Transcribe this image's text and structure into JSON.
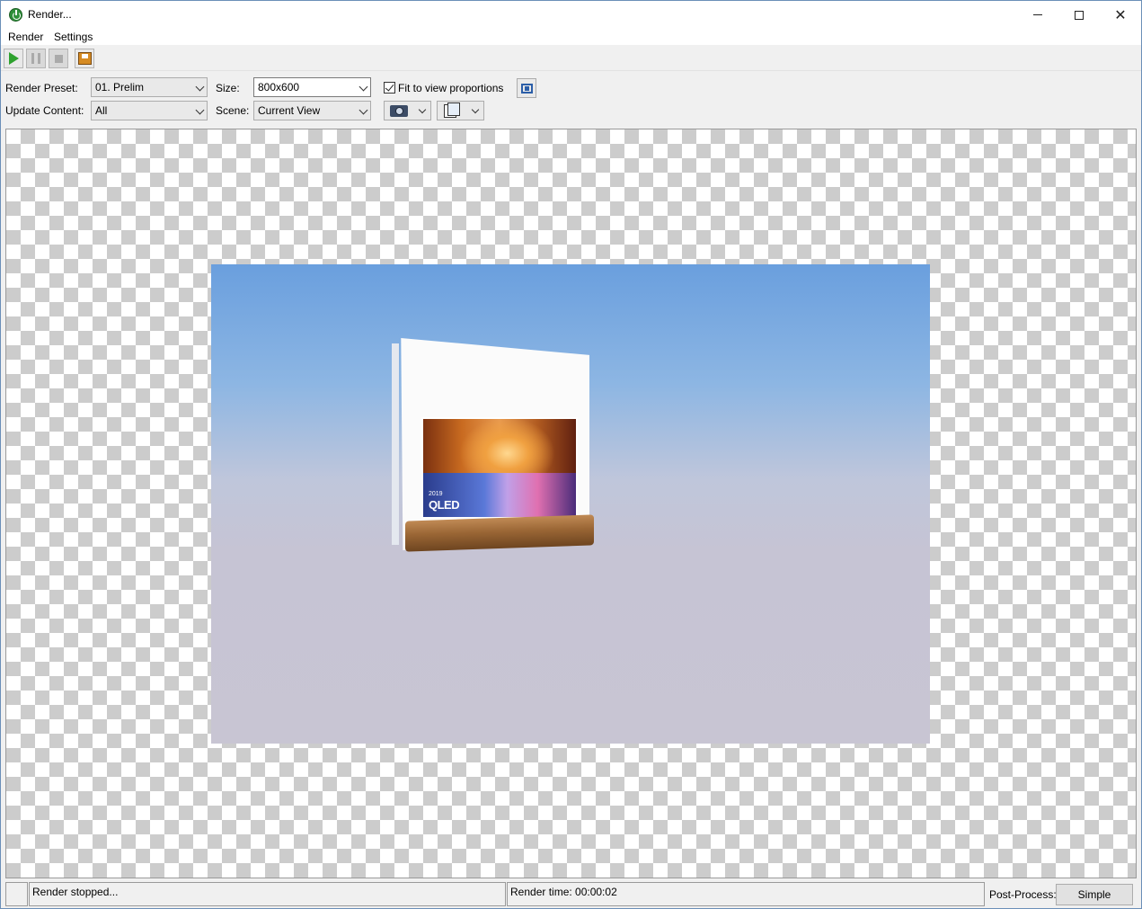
{
  "window": {
    "title": "Render...",
    "controls": {
      "minimize_icon": "minimize-icon",
      "maximize_icon": "maximize-icon",
      "close_icon": "close-icon"
    }
  },
  "menu": {
    "items": [
      "Render",
      "Settings"
    ]
  },
  "toolbar": {
    "buttons": [
      {
        "icon": "play-icon",
        "enabled": true
      },
      {
        "icon": "pause-icon",
        "enabled": false
      },
      {
        "icon": "stop-icon",
        "enabled": false
      },
      {
        "icon": "save-image-icon",
        "enabled": true
      }
    ]
  },
  "options": {
    "render_preset_label": "Render Preset:",
    "render_preset_value": "01. Prelim",
    "size_label": "Size:",
    "size_value": "800x600",
    "fit_label": "Fit to view proportions",
    "fit_checked": true,
    "update_content_label": "Update Content:",
    "update_content_value": "All",
    "scene_label": "Scene:",
    "scene_value": "Current View"
  },
  "viewport": {
    "tv": {
      "year": "2019",
      "brand": "QLED"
    }
  },
  "status": {
    "message": "Render stopped...",
    "render_time": "Render time: 00:00:02",
    "post_process_label": "Post-Process:",
    "post_process_value": "Simple"
  }
}
